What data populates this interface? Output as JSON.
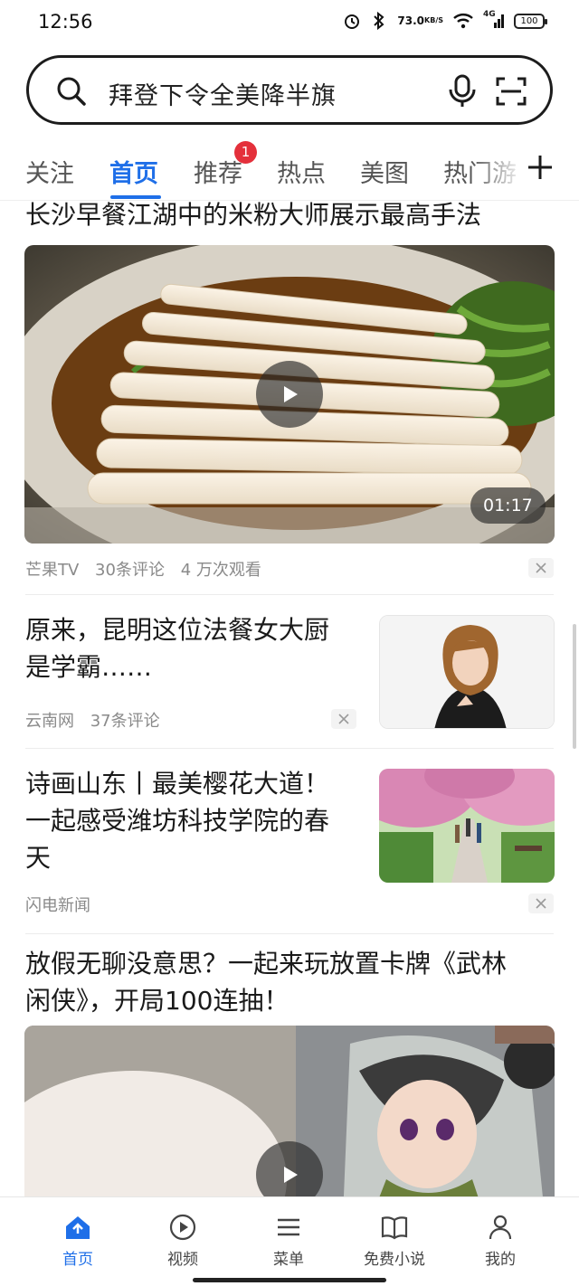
{
  "status_bar": {
    "time": "12:56",
    "net_speed_value": "73.0",
    "net_speed_unit": "KB/S",
    "signal_label": "4G",
    "battery": "100",
    "icons": [
      "alarm-icon",
      "bluetooth-icon",
      "wifi-icon",
      "signal-icon",
      "battery-icon"
    ]
  },
  "search": {
    "query": "拜登下令全美降半旗",
    "icons": [
      "search-icon",
      "microphone-icon",
      "scan-icon"
    ]
  },
  "tabs": {
    "items": [
      "关注",
      "首页",
      "推荐",
      "热点",
      "美图",
      "热门游"
    ],
    "active": "首页",
    "recommend_badge": "1",
    "more_icon": "plus-icon"
  },
  "feed": {
    "items": [
      {
        "title": "长沙早餐江湖中的米粉大师展示最高手法",
        "duration": "01:17",
        "source": "芒果TV",
        "comments": "30条评论",
        "views": "4 万次观看"
      },
      {
        "title_line1": "原来，昆明这位法餐女大厨",
        "title_line2": "是学霸……",
        "source": "云南网",
        "comments": "37条评论"
      },
      {
        "title_line1": "诗画山东丨最美樱花大道！",
        "title_line2": "一起感受潍坊科技学院的春",
        "title_line3": "天",
        "source": "闪电新闻"
      },
      {
        "title_line1": "放假无聊没意思？一起来玩放置卡牌《武林",
        "title_line2": "闲侠》，开局100连抽！"
      }
    ]
  },
  "bottom_nav": {
    "items": [
      {
        "label": "首页",
        "icon": "home-icon"
      },
      {
        "label": "视频",
        "icon": "play-circle-icon"
      },
      {
        "label": "菜单",
        "icon": "menu-icon"
      },
      {
        "label": "免费小说",
        "icon": "book-icon"
      },
      {
        "label": "我的",
        "icon": "user-icon"
      }
    ],
    "active": "首页"
  },
  "colors": {
    "accent": "#1f6fe8",
    "badge": "#e4303b",
    "meta_text": "#8a8a8a"
  }
}
